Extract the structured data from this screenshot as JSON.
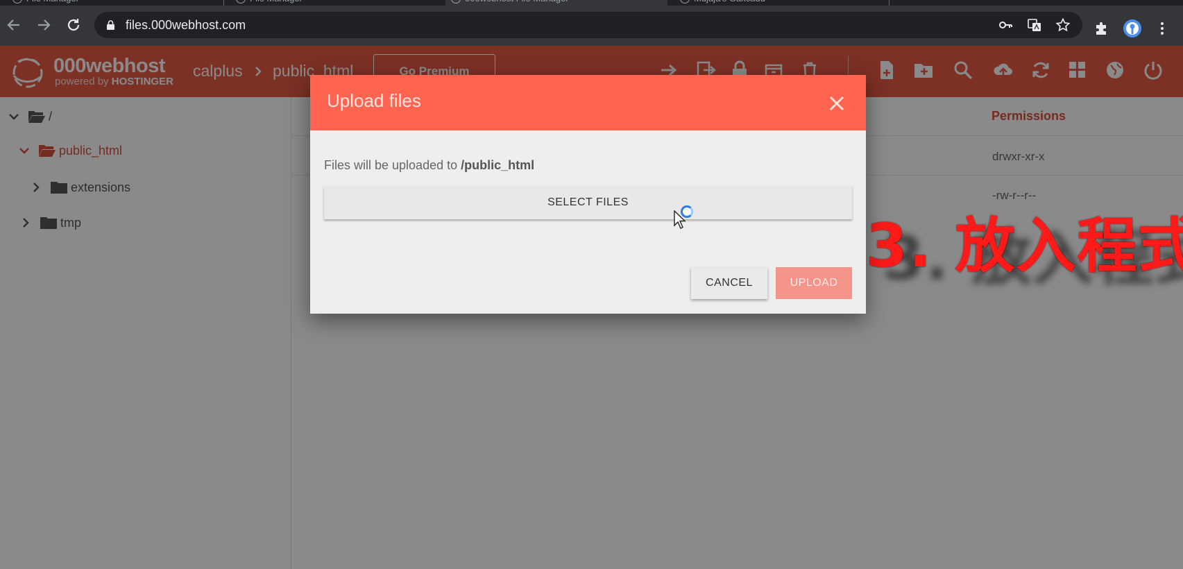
{
  "browser": {
    "tabs": [
      "File Manager",
      "File Manager",
      "000webhost File Manager",
      "Mujaja's Gakcadu"
    ],
    "url": "files.000webhost.com",
    "icons": [
      "back-icon",
      "forward-icon",
      "reload-icon",
      "lock-icon",
      "key-icon",
      "translate-icon",
      "star-icon",
      "extensions-icon",
      "profile-icon",
      "menu-icon"
    ]
  },
  "app": {
    "brand": "000webhost",
    "brand_sub_prefix": "powered by",
    "brand_sub_name": "HOSTINGER",
    "breadcrumb": [
      "calplus",
      "public_html"
    ],
    "premium_label": "Go Premium",
    "accent": "#e85a44"
  },
  "sidebar": {
    "root": "/",
    "items": [
      {
        "label": "public_html",
        "state": "open"
      },
      {
        "label": "extensions",
        "state": "closed"
      },
      {
        "label": "tmp",
        "state": "closed"
      }
    ]
  },
  "table": {
    "permissions_header": "Permissions",
    "permissions": [
      "drwxr-xr-x",
      "-rw-r--r--"
    ]
  },
  "dialog": {
    "title": "Upload files",
    "message_prefix": "Files will be uploaded to",
    "message_path": "/public_html",
    "select_label": "SELECT FILES",
    "cancel_label": "CANCEL",
    "upload_label": "UPLOAD",
    "header_color": "#ff6450"
  },
  "annotation": "3.  放入程式"
}
